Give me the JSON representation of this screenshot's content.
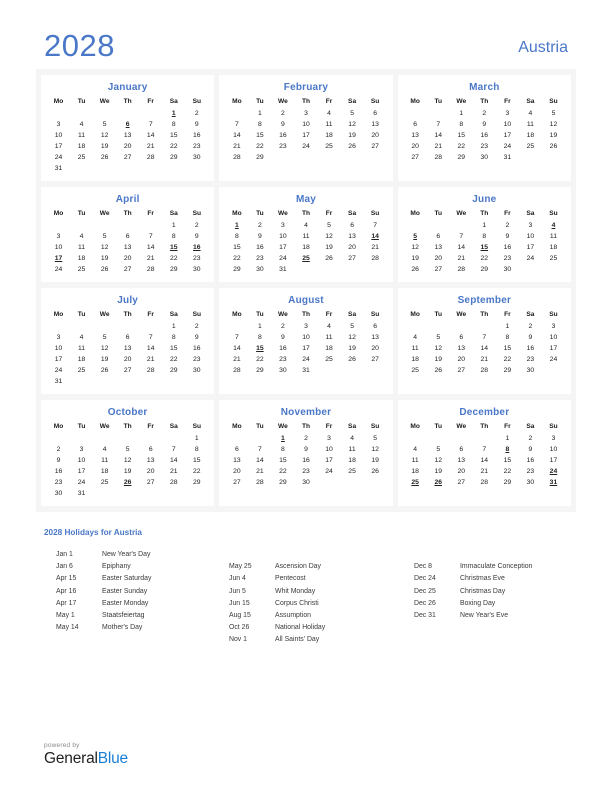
{
  "header": {
    "year": "2028",
    "country": "Austria"
  },
  "weekday_headers": [
    "Mo",
    "Tu",
    "We",
    "Th",
    "Fr",
    "Sa",
    "Su"
  ],
  "colors": {
    "accent_blue": "#4a77c7",
    "holiday_red": "#e00000",
    "brand_blue": "#1a7fd4",
    "page_tint": "#f5f5f5"
  },
  "months": [
    {
      "name": "January",
      "weeks": [
        [
          "",
          "",
          "",
          "",
          "",
          "1",
          "2"
        ],
        [
          "3",
          "4",
          "5",
          "6",
          "7",
          "8",
          "9"
        ],
        [
          "10",
          "11",
          "12",
          "13",
          "14",
          "15",
          "16"
        ],
        [
          "17",
          "18",
          "19",
          "20",
          "21",
          "22",
          "23"
        ],
        [
          "24",
          "25",
          "26",
          "27",
          "28",
          "29",
          "30"
        ],
        [
          "31",
          "",
          "",
          "",
          "",
          "",
          ""
        ]
      ],
      "holidays": [
        "1",
        "6"
      ]
    },
    {
      "name": "February",
      "weeks": [
        [
          "",
          "1",
          "2",
          "3",
          "4",
          "5",
          "6"
        ],
        [
          "7",
          "8",
          "9",
          "10",
          "11",
          "12",
          "13"
        ],
        [
          "14",
          "15",
          "16",
          "17",
          "18",
          "19",
          "20"
        ],
        [
          "21",
          "22",
          "23",
          "24",
          "25",
          "26",
          "27"
        ],
        [
          "28",
          "29",
          "",
          "",
          "",
          "",
          ""
        ]
      ],
      "holidays": []
    },
    {
      "name": "March",
      "weeks": [
        [
          "",
          "",
          "1",
          "2",
          "3",
          "4",
          "5"
        ],
        [
          "6",
          "7",
          "8",
          "9",
          "10",
          "11",
          "12"
        ],
        [
          "13",
          "14",
          "15",
          "16",
          "17",
          "18",
          "19"
        ],
        [
          "20",
          "21",
          "22",
          "23",
          "24",
          "25",
          "26"
        ],
        [
          "27",
          "28",
          "29",
          "30",
          "31",
          "",
          ""
        ]
      ],
      "holidays": []
    },
    {
      "name": "April",
      "weeks": [
        [
          "",
          "",
          "",
          "",
          "",
          "1",
          "2"
        ],
        [
          "3",
          "4",
          "5",
          "6",
          "7",
          "8",
          "9"
        ],
        [
          "10",
          "11",
          "12",
          "13",
          "14",
          "15",
          "16"
        ],
        [
          "17",
          "18",
          "19",
          "20",
          "21",
          "22",
          "23"
        ],
        [
          "24",
          "25",
          "26",
          "27",
          "28",
          "29",
          "30"
        ]
      ],
      "holidays": [
        "15",
        "16",
        "17"
      ]
    },
    {
      "name": "May",
      "weeks": [
        [
          "1",
          "2",
          "3",
          "4",
          "5",
          "6",
          "7"
        ],
        [
          "8",
          "9",
          "10",
          "11",
          "12",
          "13",
          "14"
        ],
        [
          "15",
          "16",
          "17",
          "18",
          "19",
          "20",
          "21"
        ],
        [
          "22",
          "23",
          "24",
          "25",
          "26",
          "27",
          "28"
        ],
        [
          "29",
          "30",
          "31",
          "",
          "",
          "",
          ""
        ]
      ],
      "holidays": [
        "1",
        "14",
        "25"
      ]
    },
    {
      "name": "June",
      "weeks": [
        [
          "",
          "",
          "",
          "1",
          "2",
          "3",
          "4"
        ],
        [
          "5",
          "6",
          "7",
          "8",
          "9",
          "10",
          "11"
        ],
        [
          "12",
          "13",
          "14",
          "15",
          "16",
          "17",
          "18"
        ],
        [
          "19",
          "20",
          "21",
          "22",
          "23",
          "24",
          "25"
        ],
        [
          "26",
          "27",
          "28",
          "29",
          "30",
          "",
          ""
        ]
      ],
      "holidays": [
        "4",
        "5",
        "15"
      ]
    },
    {
      "name": "July",
      "weeks": [
        [
          "",
          "",
          "",
          "",
          "",
          "1",
          "2"
        ],
        [
          "3",
          "4",
          "5",
          "6",
          "7",
          "8",
          "9"
        ],
        [
          "10",
          "11",
          "12",
          "13",
          "14",
          "15",
          "16"
        ],
        [
          "17",
          "18",
          "19",
          "20",
          "21",
          "22",
          "23"
        ],
        [
          "24",
          "25",
          "26",
          "27",
          "28",
          "29",
          "30"
        ],
        [
          "31",
          "",
          "",
          "",
          "",
          "",
          ""
        ]
      ],
      "holidays": []
    },
    {
      "name": "August",
      "weeks": [
        [
          "",
          "1",
          "2",
          "3",
          "4",
          "5",
          "6"
        ],
        [
          "7",
          "8",
          "9",
          "10",
          "11",
          "12",
          "13"
        ],
        [
          "14",
          "15",
          "16",
          "17",
          "18",
          "19",
          "20"
        ],
        [
          "21",
          "22",
          "23",
          "24",
          "25",
          "26",
          "27"
        ],
        [
          "28",
          "29",
          "30",
          "31",
          "",
          "",
          ""
        ]
      ],
      "holidays": [
        "15"
      ]
    },
    {
      "name": "September",
      "weeks": [
        [
          "",
          "",
          "",
          "",
          "1",
          "2",
          "3"
        ],
        [
          "4",
          "5",
          "6",
          "7",
          "8",
          "9",
          "10"
        ],
        [
          "11",
          "12",
          "13",
          "14",
          "15",
          "16",
          "17"
        ],
        [
          "18",
          "19",
          "20",
          "21",
          "22",
          "23",
          "24"
        ],
        [
          "25",
          "26",
          "27",
          "28",
          "29",
          "30",
          ""
        ]
      ],
      "holidays": []
    },
    {
      "name": "October",
      "weeks": [
        [
          "",
          "",
          "",
          "",
          "",
          "",
          "1"
        ],
        [
          "2",
          "3",
          "4",
          "5",
          "6",
          "7",
          "8"
        ],
        [
          "9",
          "10",
          "11",
          "12",
          "13",
          "14",
          "15"
        ],
        [
          "16",
          "17",
          "18",
          "19",
          "20",
          "21",
          "22"
        ],
        [
          "23",
          "24",
          "25",
          "26",
          "27",
          "28",
          "29"
        ],
        [
          "30",
          "31",
          "",
          "",
          "",
          "",
          ""
        ]
      ],
      "holidays": [
        "26"
      ]
    },
    {
      "name": "November",
      "weeks": [
        [
          "",
          "",
          "1",
          "2",
          "3",
          "4",
          "5"
        ],
        [
          "6",
          "7",
          "8",
          "9",
          "10",
          "11",
          "12"
        ],
        [
          "13",
          "14",
          "15",
          "16",
          "17",
          "18",
          "19"
        ],
        [
          "20",
          "21",
          "22",
          "23",
          "24",
          "25",
          "26"
        ],
        [
          "27",
          "28",
          "29",
          "30",
          "",
          "",
          ""
        ]
      ],
      "holidays": [
        "1"
      ]
    },
    {
      "name": "December",
      "weeks": [
        [
          "",
          "",
          "",
          "",
          "1",
          "2",
          "3"
        ],
        [
          "4",
          "5",
          "6",
          "7",
          "8",
          "9",
          "10"
        ],
        [
          "11",
          "12",
          "13",
          "14",
          "15",
          "16",
          "17"
        ],
        [
          "18",
          "19",
          "20",
          "21",
          "22",
          "23",
          "24"
        ],
        [
          "25",
          "26",
          "27",
          "28",
          "29",
          "30",
          "31"
        ]
      ],
      "holidays": [
        "8",
        "24",
        "25",
        "26",
        "31"
      ]
    }
  ],
  "holidays_section": {
    "heading": "2028 Holidays for Austria",
    "columns": [
      [
        {
          "date": "Jan 1",
          "name": "New Year's Day"
        },
        {
          "date": "Jan 6",
          "name": "Epiphany"
        },
        {
          "date": "Apr 15",
          "name": "Easter Saturday"
        },
        {
          "date": "Apr 16",
          "name": "Easter Sunday"
        },
        {
          "date": "Apr 17",
          "name": "Easter Monday"
        },
        {
          "date": "May 1",
          "name": "Staatsfeiertag"
        },
        {
          "date": "May 14",
          "name": "Mother's Day"
        }
      ],
      [
        {
          "date": "May 25",
          "name": "Ascension Day"
        },
        {
          "date": "Jun 4",
          "name": "Pentecost"
        },
        {
          "date": "Jun 5",
          "name": "Whit Monday"
        },
        {
          "date": "Jun 15",
          "name": "Corpus Christi"
        },
        {
          "date": "Aug 15",
          "name": "Assumption"
        },
        {
          "date": "Oct 26",
          "name": "National Holiday"
        },
        {
          "date": "Nov 1",
          "name": "All Saints' Day"
        }
      ],
      [
        {
          "date": "Dec 8",
          "name": "Immaculate Conception"
        },
        {
          "date": "Dec 24",
          "name": "Christmas Eve"
        },
        {
          "date": "Dec 25",
          "name": "Christmas Day"
        },
        {
          "date": "Dec 26",
          "name": "Boxing Day"
        },
        {
          "date": "Dec 31",
          "name": "New Year's Eve"
        }
      ]
    ],
    "column_offsets": [
      0,
      1,
      1
    ]
  },
  "footer": {
    "powered_by": "powered by",
    "brand_first": "General",
    "brand_second": "Blue"
  }
}
